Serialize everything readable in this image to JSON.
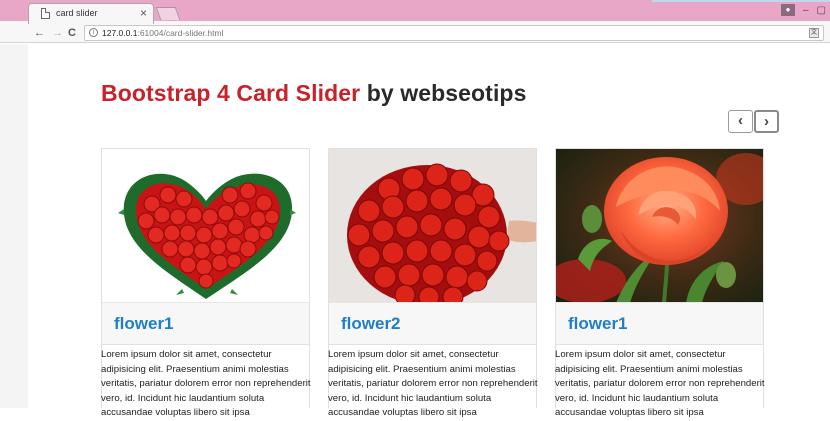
{
  "browser": {
    "tab_title": "card slider",
    "tab_close": "×",
    "url_host": "127.0.0.1",
    "url_rest": ":61004/card-slider.html",
    "nav_back": "←",
    "nav_forward": "→",
    "nav_reload": "C",
    "window_min": "–",
    "window_max": "▢"
  },
  "page": {
    "heading_accent": "Bootstrap 4 Card Slider",
    "heading_rest": "by webseotips",
    "prev_label": "‹",
    "next_label": "›",
    "cards": [
      {
        "title": "flower1",
        "image": "rose-heart-bouquet",
        "text": "Lorem ipsum dolor sit amet, consectetur adipisicing elit. Praesentium animi molestias veritatis, pariatur dolorem error non reprehenderit vero, id. Incidunt hic laudantium soluta accusandae voluptas libero sit ipsa"
      },
      {
        "title": "flower2",
        "image": "red-rose-bouquet",
        "text": "Lorem ipsum dolor sit amet, consectetur adipisicing elit. Praesentium animi molestias veritatis, pariatur dolorem error non reprehenderit vero, id. Incidunt hic laudantium soluta accusandae voluptas libero sit ipsa"
      },
      {
        "title": "flower1",
        "image": "orange-rose",
        "text": "Lorem ipsum dolor sit amet, consectetur adipisicing elit. Praesentium animi molestias veritatis, pariatur dolorem error non reprehenderit vero, id. Incidunt hic laudantium soluta accusandae voluptas libero sit ipsa"
      }
    ]
  },
  "colors": {
    "accent_red": "#c8222b",
    "card_title_blue": "#1f7fc5",
    "tabstrip_pink": "#e9a7c8"
  }
}
